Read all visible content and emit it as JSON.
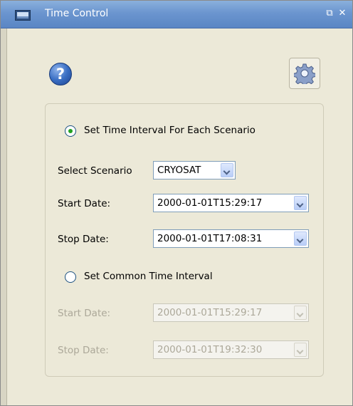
{
  "window": {
    "title": "Time Control"
  },
  "toolbar": {
    "help_icon": "question-mark",
    "settings_icon": "gear"
  },
  "per_scenario": {
    "radio_label": "Set Time Interval For Each Scenario",
    "selected": true,
    "select_scenario_label": "Select Scenario",
    "scenario_value": "CRYOSAT",
    "start_label": "Start Date:",
    "start_value": "2000-01-01T15:29:17",
    "stop_label": "Stop Date:",
    "stop_value": "2000-01-01T17:08:31"
  },
  "common": {
    "radio_label": "Set Common Time Interval",
    "selected": false,
    "start_label": "Start Date:",
    "start_value": "2000-01-01T15:29:17",
    "stop_label": "Stop Date:",
    "stop_value": "2000-01-01T19:32:30"
  }
}
